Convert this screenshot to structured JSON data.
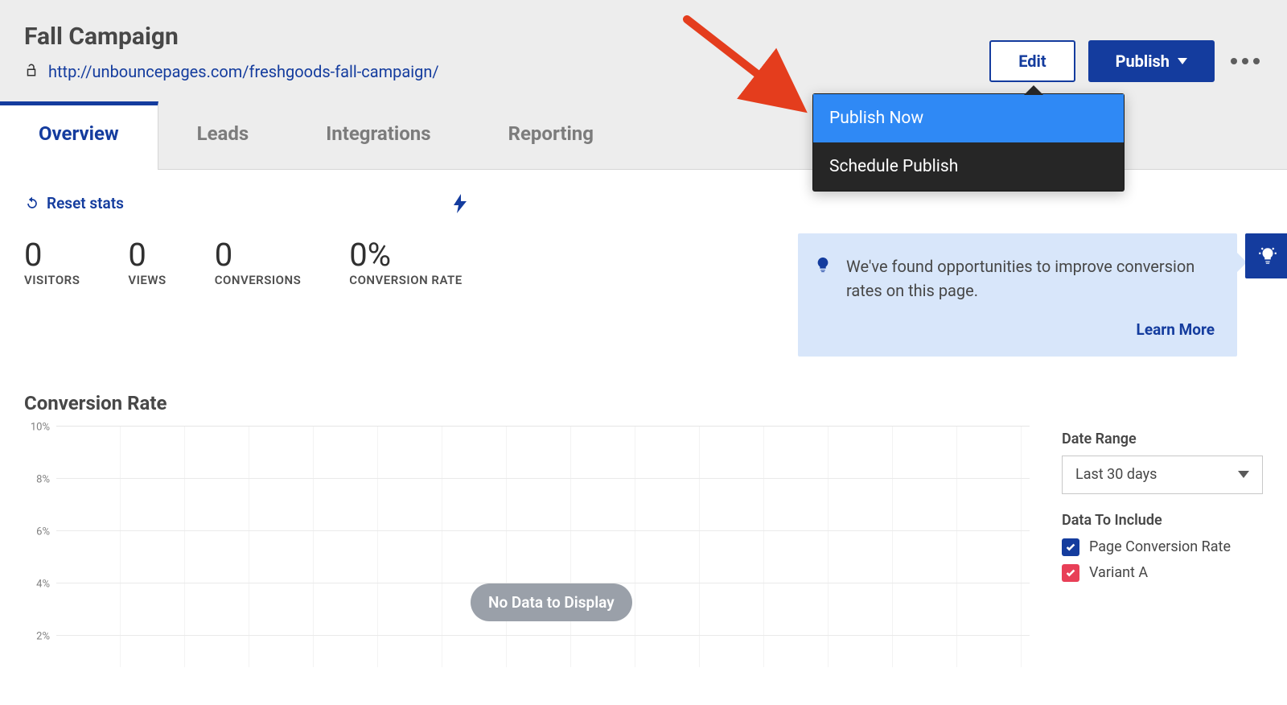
{
  "header": {
    "title": "Fall Campaign",
    "url": "http://unbouncepages.com/freshgoods-fall-campaign/",
    "edit_label": "Edit",
    "publish_label": "Publish"
  },
  "publish_menu": {
    "items": [
      "Publish Now",
      "Schedule Publish"
    ]
  },
  "tabs": [
    "Overview",
    "Leads",
    "Integrations",
    "Reporting"
  ],
  "reset_label": "Reset stats",
  "stats": {
    "visitors": {
      "value": "0",
      "label": "VISITORS"
    },
    "views": {
      "value": "0",
      "label": "VIEWS"
    },
    "conversions": {
      "value": "0",
      "label": "CONVERSIONS"
    },
    "rate": {
      "value": "0%",
      "label": "CONVERSION RATE"
    }
  },
  "notice": {
    "text": "We've found opportunities to improve conversion rates on this page.",
    "learn": "Learn More"
  },
  "chart_section": {
    "title": "Conversion Rate",
    "nodata": "No Data to Display",
    "date_range_label": "Date Range",
    "date_range_value": "Last 30 days",
    "include_label": "Data To Include",
    "include_options": [
      "Page Conversion Rate",
      "Variant A"
    ]
  },
  "chart_data": {
    "type": "line",
    "title": "Conversion Rate",
    "series": [],
    "xlabel": "",
    "ylabel": "",
    "y_ticks": [
      "10%",
      "8%",
      "6%",
      "4%",
      "2%"
    ],
    "ylim": [
      0,
      10
    ],
    "note": "No Data to Display"
  }
}
